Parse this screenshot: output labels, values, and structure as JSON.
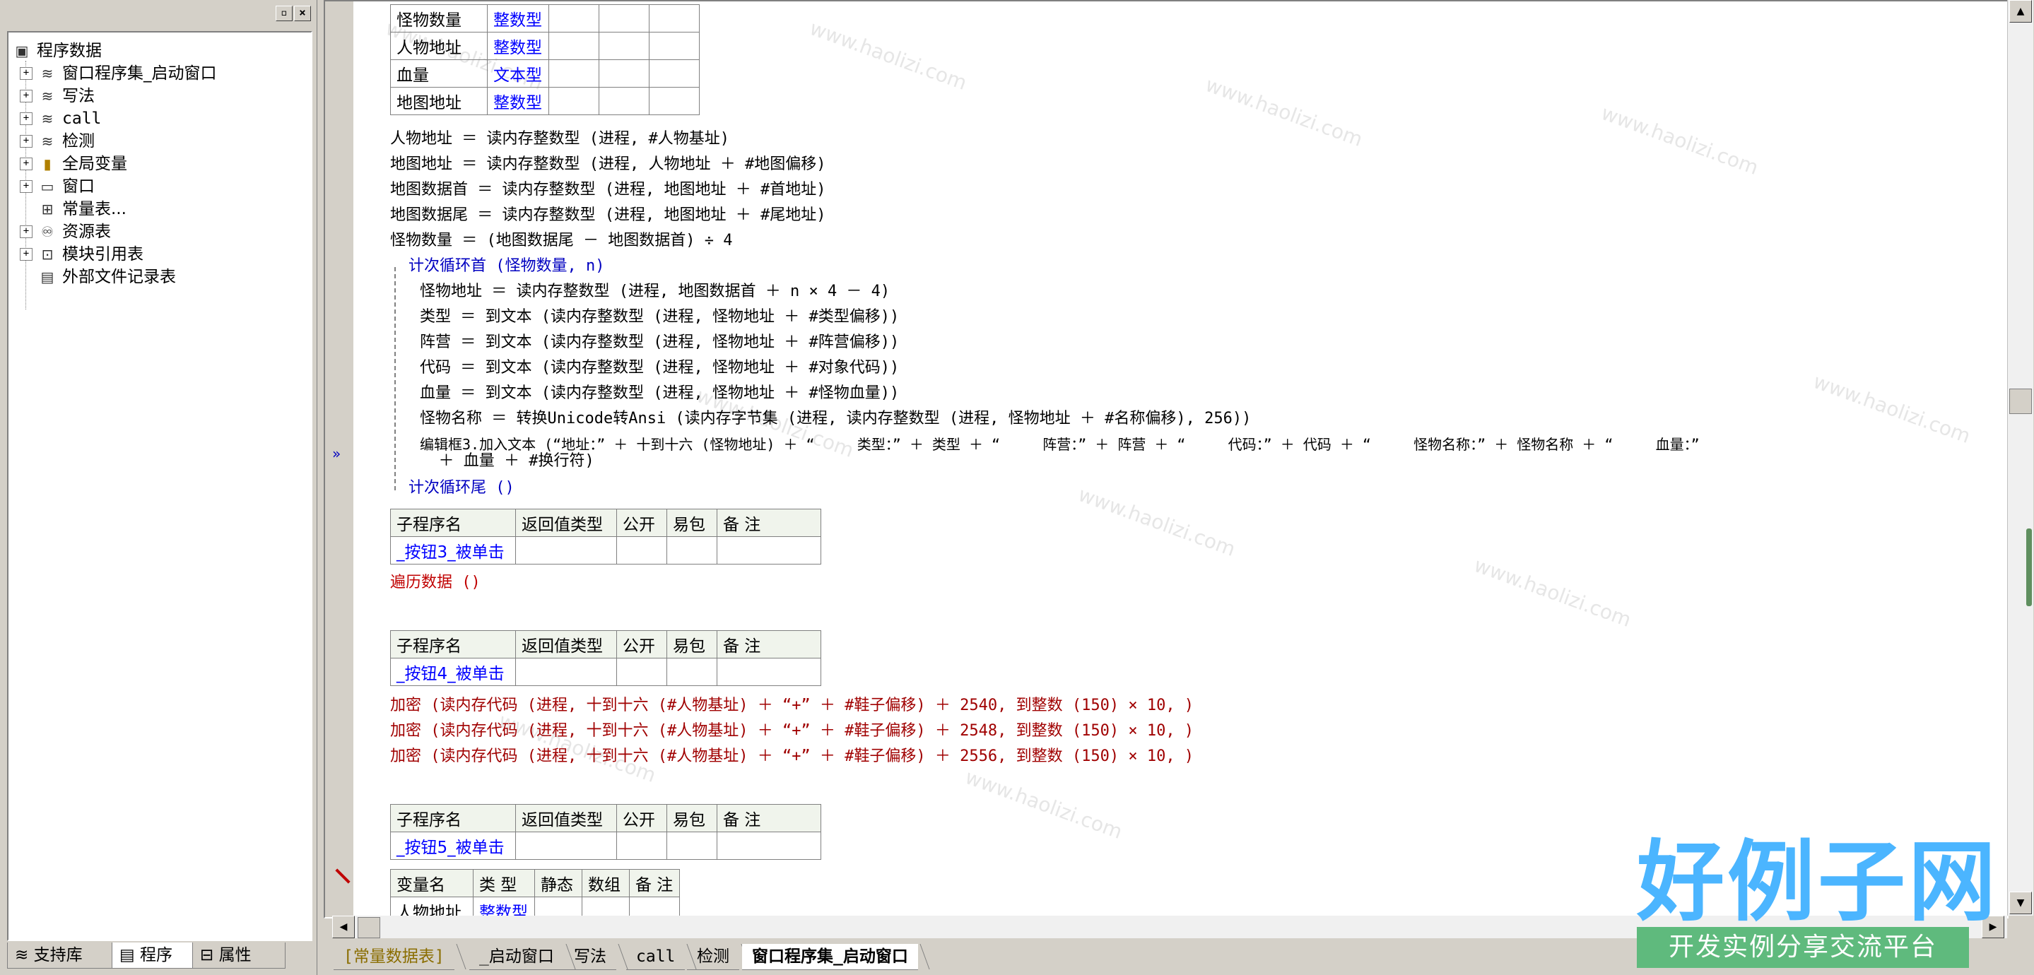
{
  "tree": {
    "root": "程序数据",
    "items": [
      {
        "label": "窗口程序集_启动窗口",
        "icon": "module-icon",
        "expandable": true
      },
      {
        "label": "写法",
        "icon": "module-icon",
        "expandable": true
      },
      {
        "label": "call",
        "icon": "module-icon",
        "expandable": true
      },
      {
        "label": "检测",
        "icon": "module-icon",
        "expandable": true
      },
      {
        "label": "全局变量",
        "icon": "global-var-icon",
        "expandable": true
      },
      {
        "label": "窗口",
        "icon": "window-icon",
        "expandable": true
      },
      {
        "label": "常量表...",
        "icon": "constant-icon",
        "expandable": false
      },
      {
        "label": "资源表",
        "icon": "resource-icon",
        "expandable": true
      },
      {
        "label": "模块引用表",
        "icon": "module-ref-icon",
        "expandable": true
      },
      {
        "label": "外部文件记录表",
        "icon": "file-record-icon",
        "expandable": false
      }
    ]
  },
  "left_tabs": [
    "支持库",
    "程序",
    "属性"
  ],
  "top_table": {
    "rows": [
      {
        "name": "怪物数量",
        "type": "整数型"
      },
      {
        "name": "人物地址",
        "type": "整数型"
      },
      {
        "name": "血量",
        "type": "文本型"
      },
      {
        "name": "地图地址",
        "type": "整数型"
      }
    ]
  },
  "code1": [
    "人物地址 ＝ 读内存整数型 (进程, #人物基址)",
    "地图地址 ＝ 读内存整数型 (进程, 人物地址 ＋ #地图偏移)",
    "地图数据首 ＝ 读内存整数型 (进程, 地图地址 ＋ #首地址)",
    "地图数据尾 ＝ 读内存整数型 (进程, 地图地址 ＋ #尾地址)",
    "怪物数量 ＝ (地图数据尾 － 地图数据首) ÷ 4"
  ],
  "loop_head": "计次循环首 (怪物数量, n)",
  "loop_body": [
    "怪物地址 ＝ 读内存整数型 (进程, 地图数据首 ＋ n × 4 － 4)",
    "类型 ＝ 到文本 (读内存整数型 (进程, 怪物地址 ＋ #类型偏移))",
    "阵营 ＝ 到文本 (读内存整数型 (进程, 怪物地址 ＋ #阵营偏移))",
    "代码 ＝ 到文本 (读内存整数型 (进程, 怪物地址 ＋ #对象代码))",
    "血量 ＝ 到文本 (读内存整数型 (进程, 怪物地址 ＋ #怪物血量))",
    "怪物名称 ＝ 转换Unicode转Ansi (读内存字节集 (进程, 读内存整数型 (进程, 怪物地址 ＋ #名称偏移), 256))",
    "编辑框3.加入文本 (“地址：” ＋ 十到十六 (怪物地址) ＋ “     类型：” ＋ 类型 ＋ “     阵营：” ＋ 阵营 ＋ “     代码：” ＋ 代码 ＋ “     怪物名称：” ＋ 怪物名称 ＋ “     血量：”",
    "  ＋ 血量 ＋ #换行符)"
  ],
  "loop_tail": "计次循环尾 ()",
  "sub_headers": [
    "子程序名",
    "返回值类型",
    "公开",
    "易包",
    "备 注"
  ],
  "sub3": {
    "name": "_按钮3_被单击",
    "code": [
      "遍历数据 ()"
    ]
  },
  "sub4": {
    "name": "_按钮4_被单击",
    "code": [
      "加密 (读内存代码 (进程, 十到十六 (#人物基址) ＋ “+” ＋ #鞋子偏移) ＋ 2540, 到整数 (150) × 10, )",
      "加密 (读内存代码 (进程, 十到十六 (#人物基址) ＋ “+” ＋ #鞋子偏移) ＋ 2548, 到整数 (150) × 10, )",
      "加密 (读内存代码 (进程, 十到十六 (#人物基址) ＋ “+” ＋ #鞋子偏移) ＋ 2556, 到整数 (150) × 10, )"
    ]
  },
  "sub5": {
    "name": "_按钮5_被单击"
  },
  "var_headers": [
    "变量名",
    "类 型",
    "静态",
    "数组",
    "备 注"
  ],
  "var_row": {
    "name": "人物地址",
    "type": "整数型"
  },
  "bottom_tabs": [
    "[常量数据表]",
    "_启动窗口",
    "写法",
    "call",
    "检测",
    "窗口程序集_启动窗口"
  ],
  "brand": {
    "big": "好例子网",
    "small": "开发实例分享交流平台"
  },
  "watermark": "www.haolizi.com"
}
